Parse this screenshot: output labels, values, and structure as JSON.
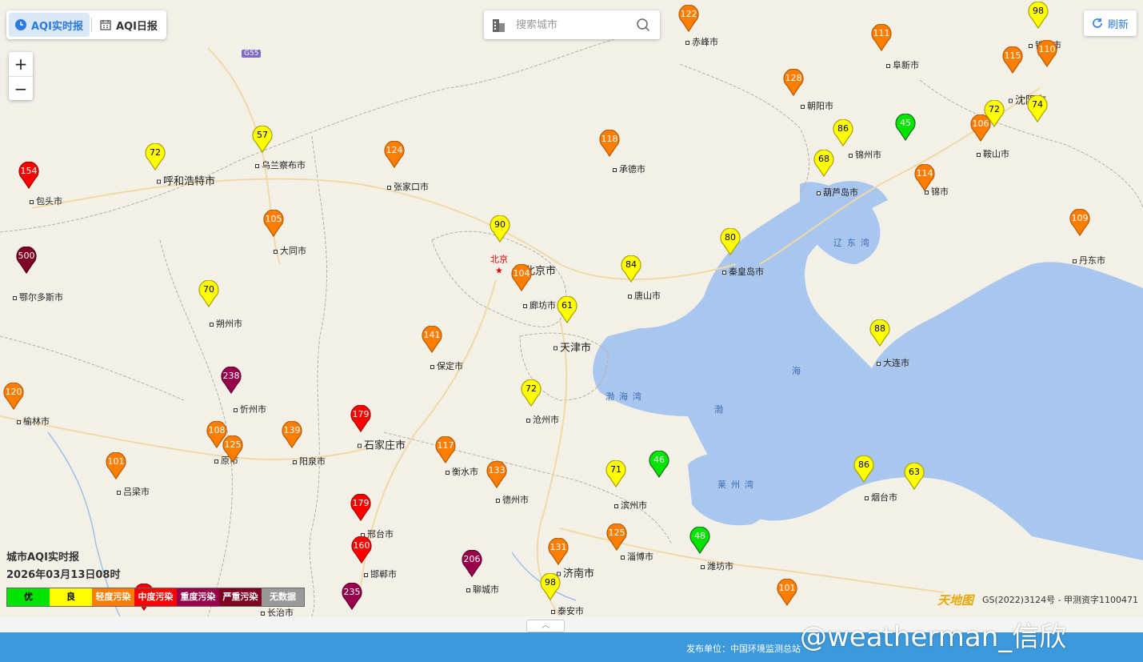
{
  "tabs": {
    "realtime": "AQI实时报",
    "daily": "AQI日报"
  },
  "search": {
    "placeholder": "搜索城市"
  },
  "zoom": {
    "in": "+",
    "out": "−"
  },
  "refresh": "刷新",
  "legend": {
    "title": "城市AQI实时报",
    "time": "2026年03月13日08时",
    "items": [
      {
        "label": "优",
        "color": "#00e400",
        "text": "#000"
      },
      {
        "label": "良",
        "color": "#ffff00",
        "text": "#000"
      },
      {
        "label": "轻度污染",
        "color": "#ff7e00",
        "text": "#fff"
      },
      {
        "label": "中度污染",
        "color": "#ff0000",
        "text": "#fff"
      },
      {
        "label": "重度污染",
        "color": "#99004c",
        "text": "#fff"
      },
      {
        "label": "严重污染",
        "color": "#7e0023",
        "text": "#fff"
      },
      {
        "label": "无数据",
        "color": "#999999",
        "text": "#fff"
      }
    ]
  },
  "capital": "北京",
  "seas": [
    "辽东湾",
    "渤海湾",
    "莱州湾",
    "渤",
    "海"
  ],
  "cities": [
    {
      "name": "赤峰市",
      "aqi": 122,
      "level": "light"
    },
    {
      "name": "铁岭市",
      "aqi": 98,
      "level": "good"
    },
    {
      "name": "阜新市",
      "aqi": 111,
      "level": "light"
    },
    {
      "name": "沈阳市",
      "aqi": 115,
      "level": "light"
    },
    {
      "name": "",
      "aqi": 110,
      "level": "light"
    },
    {
      "name": "朝阳市",
      "aqi": 128,
      "level": "light"
    },
    {
      "name": "锦州市",
      "aqi": 86,
      "level": "good"
    },
    {
      "name": "",
      "aqi": 45,
      "level": "excellent"
    },
    {
      "name": "鞍山市",
      "aqi": 106,
      "level": "light"
    },
    {
      "name": "",
      "aqi": 72,
      "level": "good"
    },
    {
      "name": "",
      "aqi": 74,
      "level": "good"
    },
    {
      "name": "乌兰察布市",
      "aqi": 57,
      "level": "good"
    },
    {
      "name": "呼和浩特市",
      "aqi": 72,
      "level": "good"
    },
    {
      "name": "张家口市",
      "aqi": 124,
      "level": "light"
    },
    {
      "name": "承德市",
      "aqi": 118,
      "level": "light"
    },
    {
      "name": "葫芦岛市",
      "aqi": 68,
      "level": "good"
    },
    {
      "name": "锦市",
      "aqi": 114,
      "level": "light"
    },
    {
      "name": "包头市",
      "aqi": 154,
      "level": "moderate"
    },
    {
      "name": "大同市",
      "aqi": 105,
      "level": "light"
    },
    {
      "name": "北京市",
      "aqi": 90,
      "level": "good"
    },
    {
      "name": "秦皇岛市",
      "aqi": 80,
      "level": "good"
    },
    {
      "name": "丹东市",
      "aqi": 109,
      "level": "light"
    },
    {
      "name": "鄂尔多斯市",
      "aqi": 500,
      "level": "severe"
    },
    {
      "name": "廊坊市",
      "aqi": 104,
      "level": "light"
    },
    {
      "name": "唐山市",
      "aqi": 84,
      "level": "good"
    },
    {
      "name": "朔州市",
      "aqi": 70,
      "level": "good"
    },
    {
      "name": "天津市",
      "aqi": 61,
      "level": "good"
    },
    {
      "name": "大连市",
      "aqi": 88,
      "level": "good"
    },
    {
      "name": "保定市",
      "aqi": 141,
      "level": "light"
    },
    {
      "name": "忻州市",
      "aqi": 238,
      "level": "heavy"
    },
    {
      "name": "沧州市",
      "aqi": 72,
      "level": "good"
    },
    {
      "name": "榆林市",
      "aqi": 120,
      "level": "light"
    },
    {
      "name": "石家庄市",
      "aqi": 179,
      "level": "moderate"
    },
    {
      "name": "原市",
      "aqi": 108,
      "level": "light"
    },
    {
      "name": "",
      "aqi": 125,
      "level": "light"
    },
    {
      "name": "阳泉市",
      "aqi": 139,
      "level": "light"
    },
    {
      "name": "衡水市",
      "aqi": 117,
      "level": "light"
    },
    {
      "name": "吕梁市",
      "aqi": 101,
      "level": "light"
    },
    {
      "name": "德州市",
      "aqi": 133,
      "level": "light"
    },
    {
      "name": "滨州市",
      "aqi": 71,
      "level": "good"
    },
    {
      "name": "",
      "aqi": 46,
      "level": "excellent"
    },
    {
      "name": "烟台市",
      "aqi": 86,
      "level": "good"
    },
    {
      "name": "",
      "aqi": 63,
      "level": "good"
    },
    {
      "name": "邢台市",
      "aqi": 179,
      "level": "moderate"
    },
    {
      "name": "淄博市",
      "aqi": 125,
      "level": "light"
    },
    {
      "name": "潍坊市",
      "aqi": 48,
      "level": "excellent"
    },
    {
      "name": "邯郸市",
      "aqi": 160,
      "level": "moderate"
    },
    {
      "name": "聊城市",
      "aqi": 206,
      "level": "heavy"
    },
    {
      "name": "济南市",
      "aqi": 131,
      "level": "light"
    },
    {
      "name": "泰安市",
      "aqi": 98,
      "level": "good"
    },
    {
      "name": "",
      "aqi": 101,
      "level": "light"
    },
    {
      "name": "长治市",
      "aqi": 235,
      "level": "heavy"
    },
    {
      "name": "",
      "aqi": 150,
      "level": "moderate"
    }
  ],
  "copyright": "GS(2022)3124号 - 甲测资字1100471",
  "map_logo": "天地图",
  "publisher": "发布单位：中国环境监测总站",
  "watermark": "@weatherman_信欣",
  "road_label": "G55"
}
